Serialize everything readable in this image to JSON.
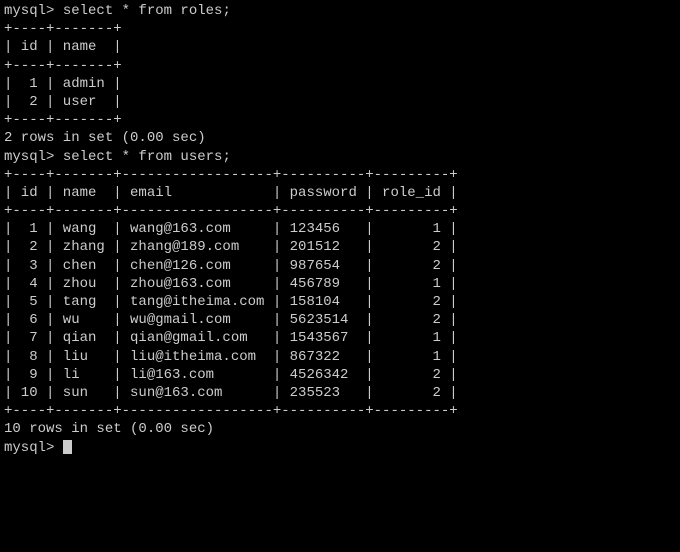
{
  "prompt1": "mysql> ",
  "query1": "select * from roles;",
  "roles_border_top": "+----+-------+",
  "roles_header": "| id | name  |",
  "roles_border_mid": "+----+-------+",
  "roles_rows": [
    "|  1 | admin |",
    "|  2 | user  |"
  ],
  "roles_border_bot": "+----+-------+",
  "roles_result": "2 rows in set (0.00 sec)",
  "blank": "",
  "prompt2": "mysql> ",
  "query2": "select * from users;",
  "users_border_top": "+----+-------+------------------+----------+---------+",
  "users_header": "| id | name  | email            | password | role_id |",
  "users_border_mid": "+----+-------+------------------+----------+---------+",
  "users_rows": [
    "|  1 | wang  | wang@163.com     | 123456   |       1 |",
    "|  2 | zhang | zhang@189.com    | 201512   |       2 |",
    "|  3 | chen  | chen@126.com     | 987654   |       2 |",
    "|  4 | zhou  | zhou@163.com     | 456789   |       1 |",
    "|  5 | tang  | tang@itheima.com | 158104   |       2 |",
    "|  6 | wu    | wu@gmail.com     | 5623514  |       2 |",
    "|  7 | qian  | qian@gmail.com   | 1543567  |       1 |",
    "|  8 | liu   | liu@itheima.com  | 867322   |       1 |",
    "|  9 | li    | li@163.com       | 4526342  |       2 |",
    "| 10 | sun   | sun@163.com      | 235523   |       2 |"
  ],
  "users_border_bot": "+----+-------+------------------+----------+---------+",
  "users_result": "10 rows in set (0.00 sec)",
  "prompt3": "mysql> "
}
